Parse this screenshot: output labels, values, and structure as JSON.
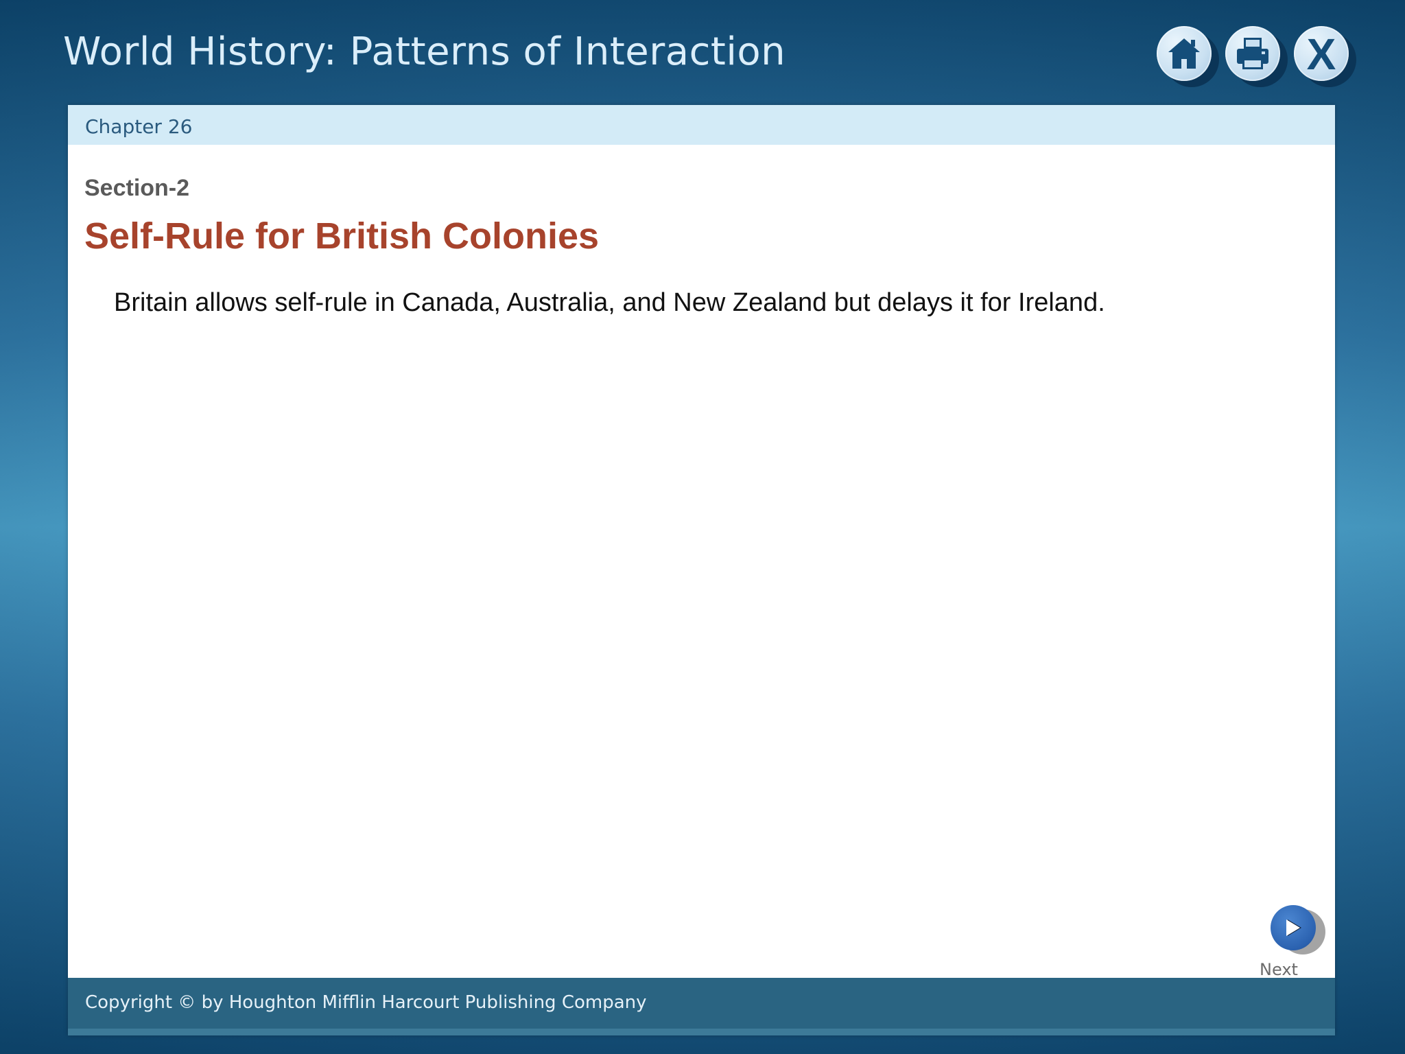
{
  "header": {
    "app_title": "World History: Patterns of Interaction",
    "buttons": [
      {
        "name": "home",
        "icon": "home-icon"
      },
      {
        "name": "print",
        "icon": "printer-icon"
      },
      {
        "name": "close",
        "icon": "close-icon",
        "label": "X"
      }
    ]
  },
  "slide": {
    "chapter": "Chapter 26",
    "section_label": "Section-2",
    "title": "Self-Rule for British Colonies",
    "body": "Britain allows self-rule in Canada, Australia, and New Zealand but delays it for Ireland."
  },
  "navigation": {
    "next_label": "Next",
    "next_icon": "play-arrow-icon"
  },
  "footer": {
    "copyright": "Copyright © by Houghton Mifflin Harcourt Publishing Company"
  },
  "colors": {
    "background": "#2f7fb3",
    "chapter_bar": "#d3ebf7",
    "title_red": "#a7432c",
    "footer": "#2a6482",
    "next_button": "#2b62b0"
  }
}
